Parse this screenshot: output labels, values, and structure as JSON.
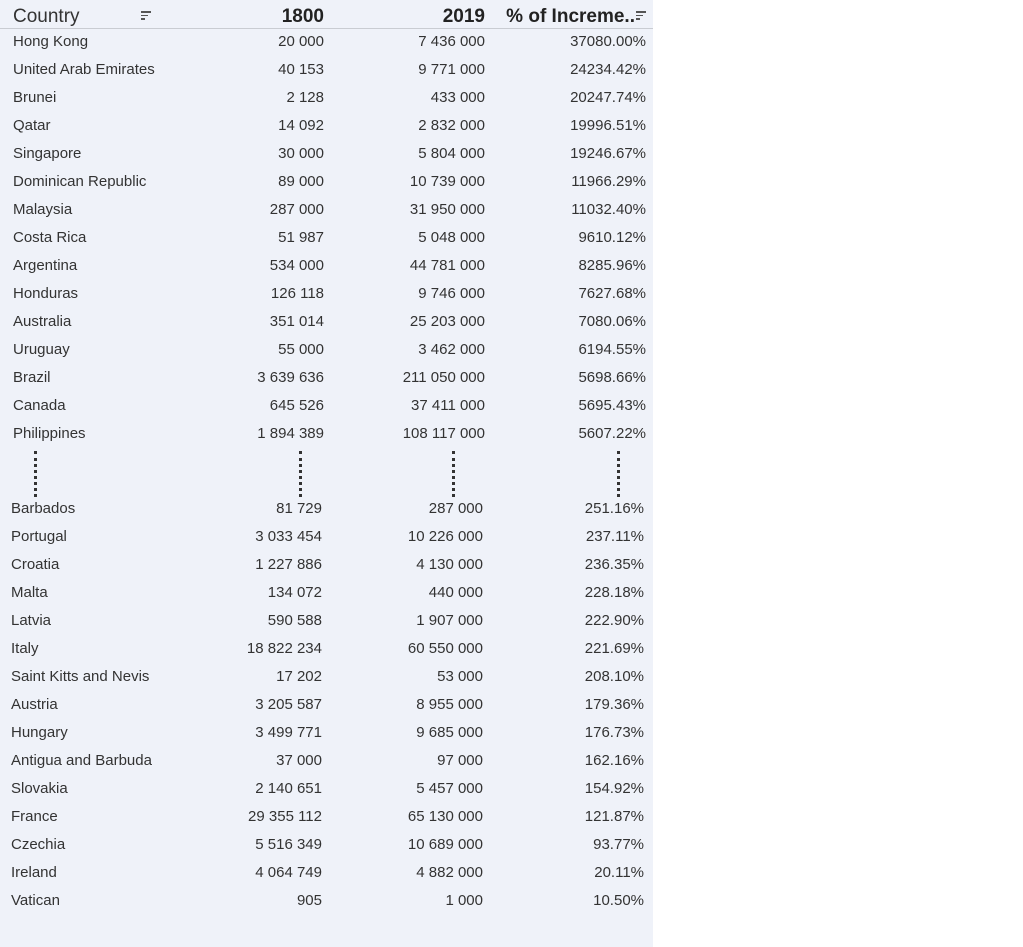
{
  "chart_data": {
    "type": "table",
    "columns": [
      "Country",
      "1800",
      "2019",
      "% of Increme.."
    ],
    "top_rows": [
      {
        "country": "Hong Kong",
        "y1800": "20 000",
        "y2019": "7 436 000",
        "inc": "37080.00%"
      },
      {
        "country": "United Arab Emirates",
        "y1800": "40 153",
        "y2019": "9 771 000",
        "inc": "24234.42%"
      },
      {
        "country": "Brunei",
        "y1800": "2 128",
        "y2019": "433 000",
        "inc": "20247.74%"
      },
      {
        "country": "Qatar",
        "y1800": "14 092",
        "y2019": "2 832 000",
        "inc": "19996.51%"
      },
      {
        "country": "Singapore",
        "y1800": "30 000",
        "y2019": "5 804 000",
        "inc": "19246.67%"
      },
      {
        "country": "Dominican Republic",
        "y1800": "89 000",
        "y2019": "10 739 000",
        "inc": "11966.29%"
      },
      {
        "country": "Malaysia",
        "y1800": "287 000",
        "y2019": "31 950 000",
        "inc": "11032.40%"
      },
      {
        "country": "Costa Rica",
        "y1800": "51 987",
        "y2019": "5 048 000",
        "inc": "9610.12%"
      },
      {
        "country": "Argentina",
        "y1800": "534 000",
        "y2019": "44 781 000",
        "inc": "8285.96%"
      },
      {
        "country": "Honduras",
        "y1800": "126 118",
        "y2019": "9 746 000",
        "inc": "7627.68%"
      },
      {
        "country": "Australia",
        "y1800": "351 014",
        "y2019": "25 203 000",
        "inc": "7080.06%"
      },
      {
        "country": "Uruguay",
        "y1800": "55 000",
        "y2019": "3 462 000",
        "inc": "6194.55%"
      },
      {
        "country": "Brazil",
        "y1800": "3 639 636",
        "y2019": "211 050 000",
        "inc": "5698.66%"
      },
      {
        "country": "Canada",
        "y1800": "645 526",
        "y2019": "37 411 000",
        "inc": "5695.43%"
      },
      {
        "country": "Philippines",
        "y1800": "1 894 389",
        "y2019": "108 117 000",
        "inc": "5607.22%"
      }
    ],
    "bottom_rows": [
      {
        "country": "Barbados",
        "y1800": "81 729",
        "y2019": "287 000",
        "inc": "251.16%"
      },
      {
        "country": "Portugal",
        "y1800": "3 033 454",
        "y2019": "10 226 000",
        "inc": "237.11%"
      },
      {
        "country": "Croatia",
        "y1800": "1 227 886",
        "y2019": "4 130 000",
        "inc": "236.35%"
      },
      {
        "country": "Malta",
        "y1800": "134 072",
        "y2019": "440 000",
        "inc": "228.18%"
      },
      {
        "country": "Latvia",
        "y1800": "590 588",
        "y2019": "1 907 000",
        "inc": "222.90%"
      },
      {
        "country": "Italy",
        "y1800": "18 822 234",
        "y2019": "60 550 000",
        "inc": "221.69%"
      },
      {
        "country": "Saint Kitts and Nevis",
        "y1800": "17 202",
        "y2019": "53 000",
        "inc": "208.10%"
      },
      {
        "country": "Austria",
        "y1800": "3 205 587",
        "y2019": "8 955 000",
        "inc": "179.36%"
      },
      {
        "country": "Hungary",
        "y1800": "3 499 771",
        "y2019": "9 685 000",
        "inc": "176.73%"
      },
      {
        "country": "Antigua and Barbuda",
        "y1800": "37 000",
        "y2019": "97 000",
        "inc": "162.16%"
      },
      {
        "country": "Slovakia",
        "y1800": "2 140 651",
        "y2019": "5 457 000",
        "inc": "154.92%"
      },
      {
        "country": "France",
        "y1800": "29 355 112",
        "y2019": "65 130 000",
        "inc": "121.87%"
      },
      {
        "country": "Czechia",
        "y1800": "5 516 349",
        "y2019": "10 689 000",
        "inc": "93.77%"
      },
      {
        "country": "Ireland",
        "y1800": "4 064 749",
        "y2019": "4 882 000",
        "inc": "20.11%"
      },
      {
        "country": "Vatican",
        "y1800": "905",
        "y2019": "1 000",
        "inc": "10.50%"
      }
    ]
  },
  "colors": {
    "panel": "#eff2f9",
    "text": "#333333",
    "header_text": "#222222"
  }
}
